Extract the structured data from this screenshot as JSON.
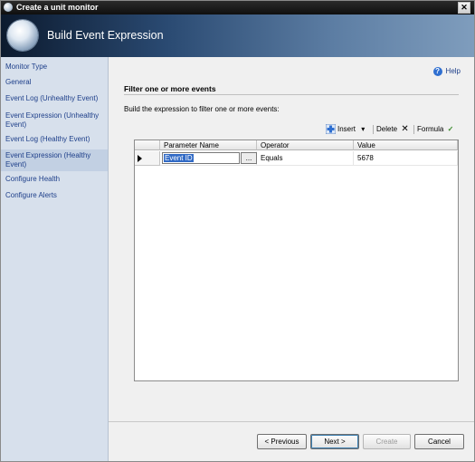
{
  "window": {
    "title": "Create a unit monitor",
    "close_glyph": "✕"
  },
  "banner": {
    "title": "Build Event Expression"
  },
  "sidebar": {
    "items": [
      {
        "label": "Monitor Type",
        "active": false
      },
      {
        "label": "General",
        "active": false
      },
      {
        "label": "Event Log (Unhealthy Event)",
        "active": false
      },
      {
        "label": "Event Expression (Unhealthy Event)",
        "active": false
      },
      {
        "label": "Event Log (Healthy Event)",
        "active": false
      },
      {
        "label": "Event Expression (Healthy Event)",
        "active": true
      },
      {
        "label": "Configure Health",
        "active": false
      },
      {
        "label": "Configure Alerts",
        "active": false
      }
    ]
  },
  "help": {
    "label": "Help",
    "icon": "help-icon"
  },
  "section": {
    "title": "Filter one or more events",
    "description": "Build the expression to filter one or more events:"
  },
  "toolbar": {
    "insert_label": "Insert",
    "delete_label": "Delete",
    "formula_label": "Formula",
    "dropdown_glyph": "▾",
    "delete_glyph": "✕",
    "formula_glyph": "✓"
  },
  "grid": {
    "columns": [
      "Parameter Name",
      "Operator",
      "Value"
    ],
    "rows": [
      {
        "parameter": "Event ID",
        "operator": "Equals",
        "value": "5678",
        "ellipsis": "..."
      }
    ]
  },
  "footer": {
    "previous_label": "< Previous",
    "next_label": "Next >",
    "create_label": "Create",
    "cancel_label": "Cancel"
  }
}
